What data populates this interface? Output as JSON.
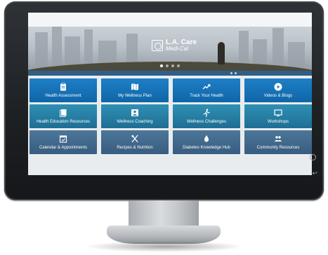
{
  "brand": {
    "line1": "L.A. Care",
    "line2": "Medi-Cal"
  },
  "hero": {
    "carousel_dots": 4,
    "active_dot": 0
  },
  "tiles": [
    {
      "label": "Health Assessment",
      "icon": "clipboard-icon"
    },
    {
      "label": "My Wellness Plan",
      "icon": "map-icon"
    },
    {
      "label": "Track Your Health",
      "icon": "trend-up-icon"
    },
    {
      "label": "Videos & Blogs",
      "icon": "play-icon"
    },
    {
      "label": "Health Education Resources",
      "icon": "book-icon"
    },
    {
      "label": "Wellness Coaching",
      "icon": "coach-icon"
    },
    {
      "label": "Wellness Challenges",
      "icon": "run-icon"
    },
    {
      "label": "Workshops",
      "icon": "screen-icon"
    },
    {
      "label": "Calendar & Appointments",
      "icon": "calendar-icon"
    },
    {
      "label": "Recipes & Nutrition",
      "icon": "utensils-icon"
    },
    {
      "label": "Diabetes Knowledge Hub",
      "icon": "diabetes-icon"
    },
    {
      "label": "Community Resources",
      "icon": "people-icon"
    }
  ],
  "colors": {
    "tile_row1": "#1a78bf",
    "tile_row2": "#2a86ac",
    "tile_row3": "#446b8e",
    "bezel": "#1d2023"
  }
}
